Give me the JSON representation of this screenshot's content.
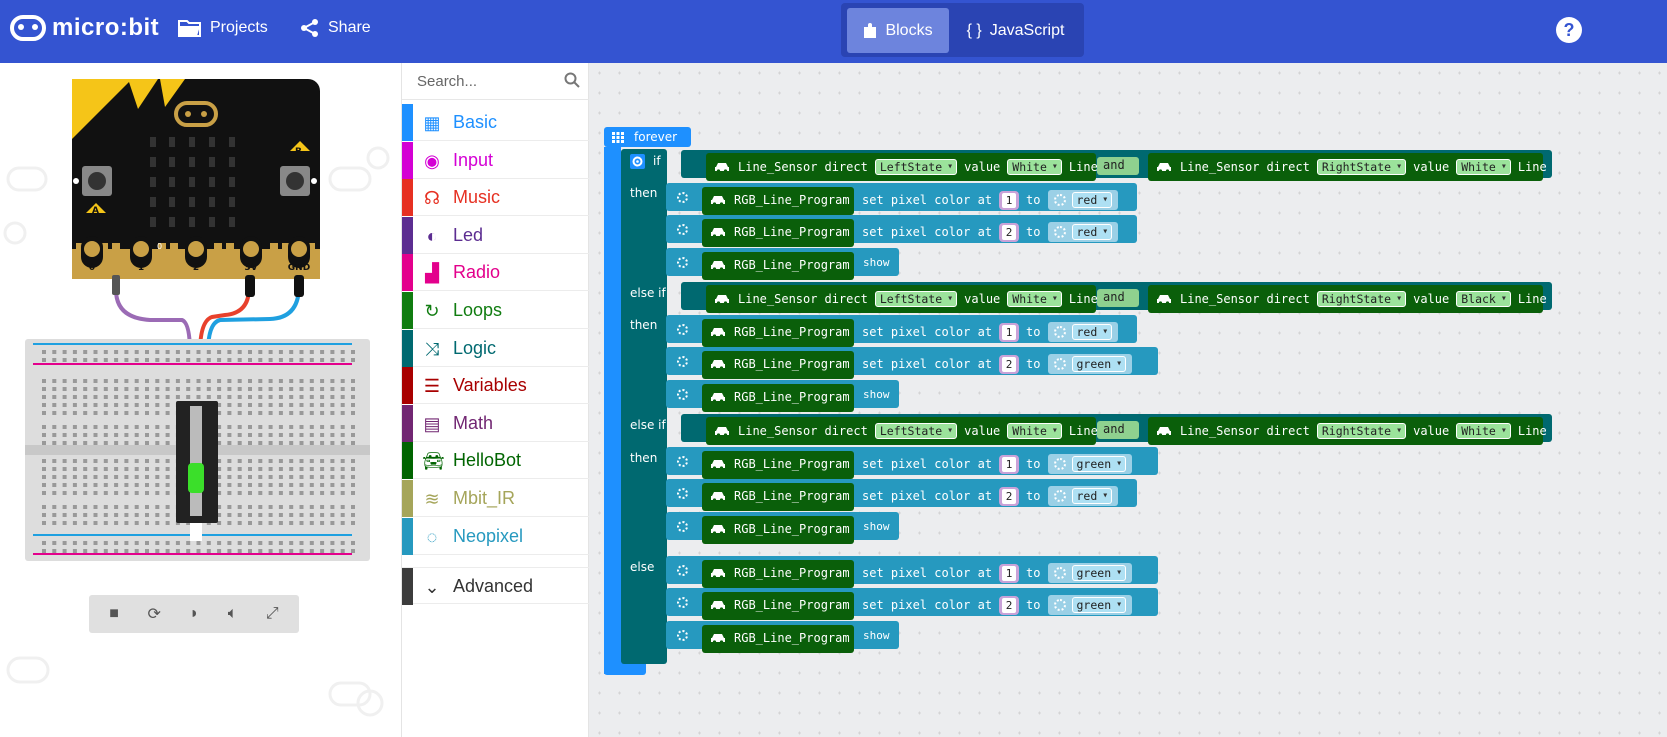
{
  "app": {
    "title": "micro:bit"
  },
  "header": {
    "projects_label": "Projects",
    "share_label": "Share",
    "blocks_label": "Blocks",
    "javascript_label": "JavaScript",
    "help_label": "?"
  },
  "simulator": {
    "board_pins": [
      "0",
      "1",
      "2",
      "3V",
      "GND"
    ],
    "button_a": "A",
    "button_b": "B",
    "pin_marker": "0"
  },
  "toolbox": {
    "search_placeholder": "Search...",
    "categories": [
      {
        "label": "Basic",
        "color": "#1e90ff"
      },
      {
        "label": "Input",
        "color": "#d400d4"
      },
      {
        "label": "Music",
        "color": "#e63022"
      },
      {
        "label": "Led",
        "color": "#5c2d91"
      },
      {
        "label": "Radio",
        "color": "#e3008c"
      },
      {
        "label": "Loops",
        "color": "#107c10"
      },
      {
        "label": "Logic",
        "color": "#006970"
      },
      {
        "label": "Variables",
        "color": "#a80000"
      },
      {
        "label": "Math",
        "color": "#712672"
      },
      {
        "label": "HelloBot",
        "color": "#006400"
      },
      {
        "label": "Mbit_IR",
        "color": "#a5a55a"
      },
      {
        "label": "Neopixel",
        "color": "#2699bf"
      }
    ],
    "advanced_label": "Advanced"
  },
  "workspace": {
    "forever_label": "forever",
    "if_label": "if",
    "then_label": "then",
    "else_if_label": "else if",
    "else_label": "else",
    "and_label": "and",
    "line_sensor_label": "Line_Sensor",
    "direct_label": "direct",
    "value_label": "value",
    "line_label": "Line",
    "rgb_label": "RGB_Line_Program",
    "set_pixel_label": "set pixel color at",
    "to_label": "to",
    "show_label": "show",
    "conditions": [
      {
        "left_state": "LeftState",
        "left_value": "White",
        "right_state": "RightState",
        "right_value": "White"
      },
      {
        "left_state": "LeftState",
        "left_value": "White",
        "right_state": "RightState",
        "right_value": "Black"
      },
      {
        "left_state": "LeftState",
        "left_value": "White",
        "right_state": "RightState",
        "right_value": "White"
      }
    ],
    "branches": [
      {
        "pixels": [
          {
            "index": "1",
            "color": "red"
          },
          {
            "index": "2",
            "color": "red"
          }
        ]
      },
      {
        "pixels": [
          {
            "index": "1",
            "color": "red"
          },
          {
            "index": "2",
            "color": "green"
          }
        ]
      },
      {
        "pixels": [
          {
            "index": "1",
            "color": "green"
          },
          {
            "index": "2",
            "color": "red"
          }
        ]
      },
      {
        "pixels": [
          {
            "index": "1",
            "color": "green"
          },
          {
            "index": "2",
            "color": "green"
          }
        ]
      }
    ]
  }
}
